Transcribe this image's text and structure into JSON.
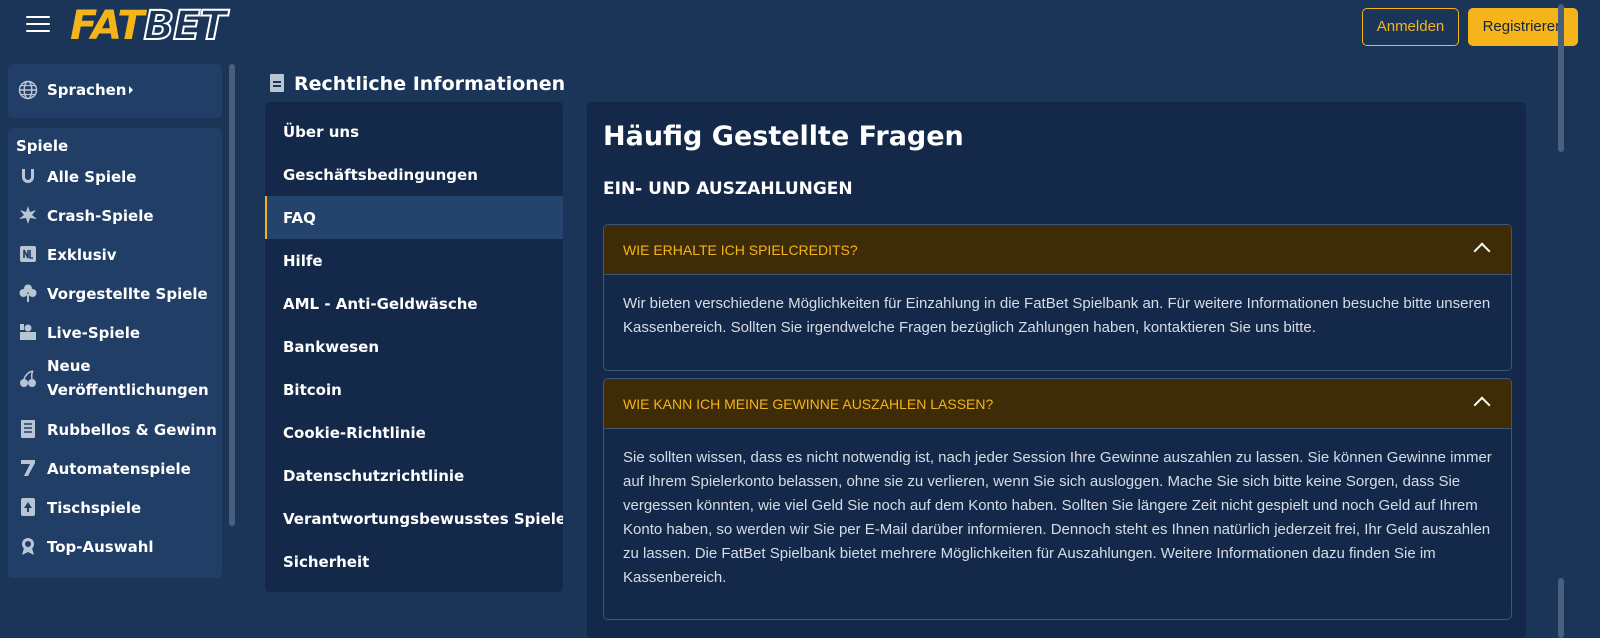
{
  "header": {
    "logo_fat": "FAT",
    "logo_bet": "BET",
    "login_label": "Anmelden",
    "register_label": "Registrieren"
  },
  "sidebar": {
    "language_label": "Sprachen",
    "games_heading": "Spiele",
    "items": [
      {
        "label": "Alle Spiele",
        "icon": "horseshoe-icon"
      },
      {
        "label": "Crash-Spiele",
        "icon": "burst-icon"
      },
      {
        "label": "Exklusiv",
        "icon": "exclusive-icon"
      },
      {
        "label": "Vorgestellte Spiele",
        "icon": "clover-icon"
      },
      {
        "label": "Live-Spiele",
        "icon": "live-dealer-icon"
      },
      {
        "label": "Neue Veröffentlichungen",
        "icon": "cherries-icon"
      },
      {
        "label": "Rubbellos & Gewinn",
        "icon": "scratch-card-icon"
      },
      {
        "label": "Automatenspiele",
        "icon": "seven-icon"
      },
      {
        "label": "Tischspiele",
        "icon": "card-spade-icon"
      },
      {
        "label": "Top-Auswahl",
        "icon": "award-icon"
      }
    ]
  },
  "legal": {
    "title": "Rechtliche Informationen",
    "items": [
      {
        "label": "Über uns",
        "active": false
      },
      {
        "label": "Geschäftsbedingungen",
        "active": false
      },
      {
        "label": "FAQ",
        "active": true
      },
      {
        "label": "Hilfe",
        "active": false
      },
      {
        "label": "AML - Anti-Geldwäsche",
        "active": false
      },
      {
        "label": "Bankwesen",
        "active": false
      },
      {
        "label": "Bitcoin",
        "active": false
      },
      {
        "label": "Cookie-Richtlinie",
        "active": false
      },
      {
        "label": "Datenschutzrichtlinie",
        "active": false
      },
      {
        "label": "Verantwortungsbewusstes Spielen",
        "active": false
      },
      {
        "label": "Sicherheit",
        "active": false
      }
    ]
  },
  "content": {
    "title": "Häufig Gestellte Fragen",
    "section": "EIN- UND AUSZAHLUNGEN",
    "faqs": [
      {
        "question": "WIE ERHALTE ICH SPIELCREDITS?",
        "answer": "Wir bieten verschiedene Möglichkeiten für Einzahlung in die FatBet Spielbank an. Für weitere Informationen besuche bitte unseren Kassenbereich. Sollten Sie irgendwelche Fragen bezüglich Zahlungen haben, kontaktieren Sie uns bitte."
      },
      {
        "question": "WIE KANN ICH MEINE GEWINNE AUSZAHLEN LASSEN?",
        "answer": "Sie sollten wissen, dass es nicht notwendig ist, nach jeder Session Ihre Gewinne auszahlen zu lassen. Sie können Gewinne immer auf Ihrem Spielerkonto belassen, ohne sie zu verlieren, wenn Sie sich ausloggen. Mache Sie sich bitte keine Sorgen, dass Sie vergessen könnten, wie viel Geld Sie noch auf dem Konto haben. Sollten Sie längere Zeit nicht gespielt und noch Geld auf Ihrem Konto haben, so werden wir Sie per E-Mail darüber informieren. Dennoch steht es Ihnen natürlich jederzeit frei, Ihr Geld auszahlen zu lassen. Die FatBet Spielbank bietet mehrere Möglichkeiten für Auszahlungen. Weitere Informationen dazu finden Sie im Kassenbereich."
      }
    ]
  },
  "colors": {
    "background": "#1b3558",
    "accent": "#f5b419",
    "panel": "#14294a"
  }
}
